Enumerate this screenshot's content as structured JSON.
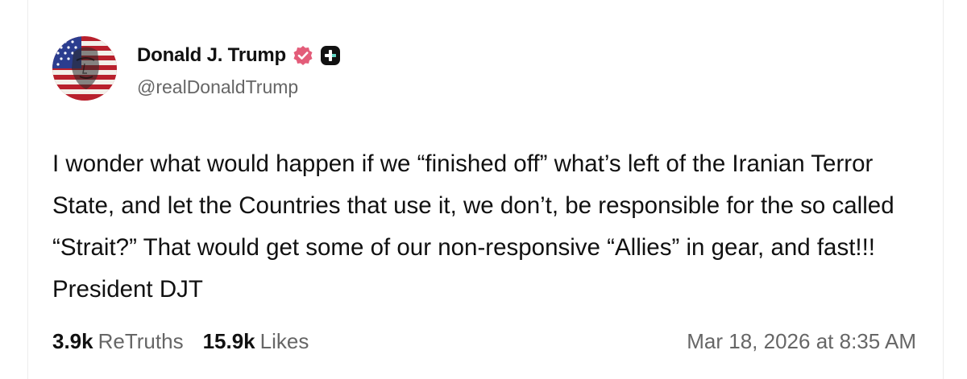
{
  "author": {
    "display_name": "Donald J. Trump",
    "handle": "@realDonaldTrump",
    "avatar_icon": "flag-portrait-avatar",
    "verified_icon": "verified-badge-icon",
    "verified_color": "#e35c79",
    "plus_icon": "plus-badge-icon",
    "plus_color": "#111111"
  },
  "post": {
    "text": "I wonder what would happen if we “finished off” what’s left of the Iranian Terror State, and let the Countries that use it, we don’t, be responsible for the so called “Strait?” That would get some of our non-responsive “Allies” in gear, and fast!!! President DJT"
  },
  "stats": {
    "retruths_count": "3.9k",
    "retruths_label": "ReTruths",
    "likes_count": "15.9k",
    "likes_label": "Likes"
  },
  "timestamp": "Mar 18, 2026 at 8:35 AM"
}
